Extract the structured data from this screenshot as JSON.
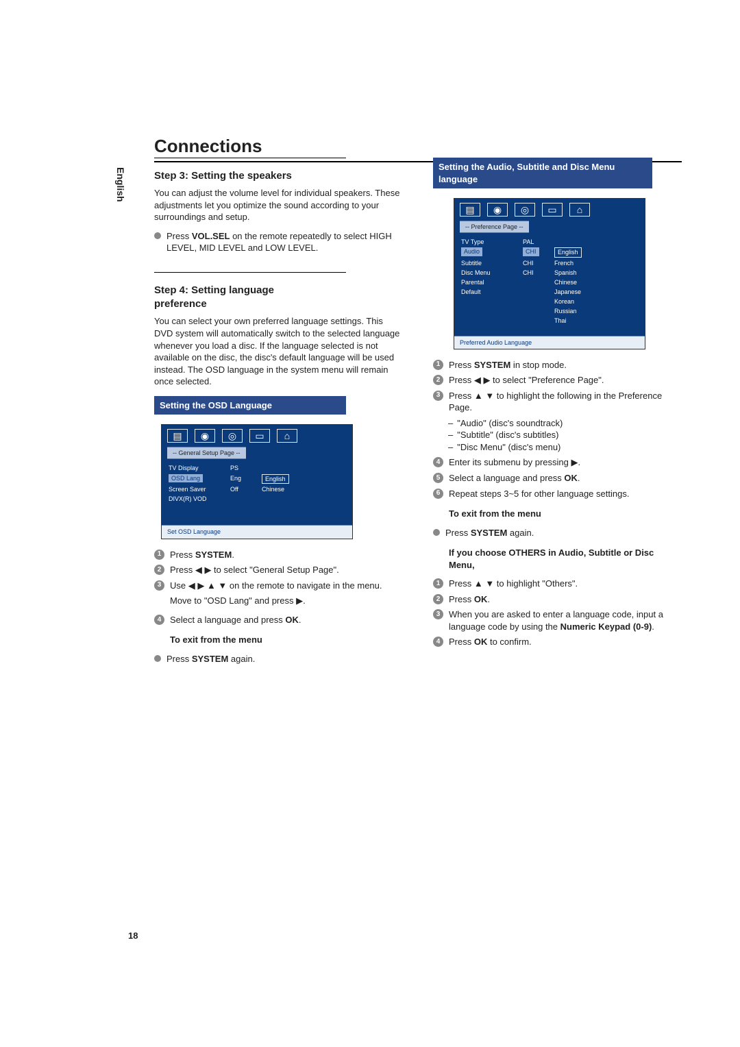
{
  "lang_tab": "English",
  "title": "Connections",
  "page_number": "18",
  "left": {
    "step3_title": "Step 3:  Setting the speakers",
    "step3_text": "You can adjust the volume level for individual speakers. These adjustments let you optimize the sound according to your surroundings and setup.",
    "step3_bullet_pre": "Press ",
    "step3_bullet_bold": "VOL.SEL",
    "step3_bullet_post": " on the remote repeatedly to select HIGH LEVEL, MID LEVEL and LOW LEVEL.",
    "step4_title": "Step 4:  Setting language preference",
    "step4_text": "You can select your own preferred language settings. This DVD system will automatically switch to the selected language whenever you load a disc. If the language selected is not available on the disc, the disc's default language will be used instead. The OSD language in the system menu will remain once selected.",
    "osd_bar": "Setting the OSD Language",
    "osd_fig": {
      "title": "-- General Setup Page --",
      "rows": [
        {
          "a": "TV Display",
          "b": "PS",
          "c": ""
        },
        {
          "a": "OSD Lang",
          "b": "Eng",
          "c": "English",
          "hlA": true,
          "boxC": true
        },
        {
          "a": "Screen Saver",
          "b": "Off",
          "c": "Chinese"
        },
        {
          "a": "DIVX(R) VOD",
          "b": "",
          "c": ""
        }
      ],
      "footer": "Set OSD Language"
    },
    "s1_pre": "Press ",
    "s1_bold": "SYSTEM",
    "s1_post": ".",
    "s2": "Press ◀ ▶ to select \"General Setup Page\".",
    "s3": "Use ◀ ▶ ▲ ▼ on the remote to navigate in the menu.",
    "s3b": "Move to \"OSD Lang\" and press ▶.",
    "s4_pre": "Select a language and press ",
    "s4_bold": "OK",
    "s4_post": ".",
    "exit_hd": "To exit from the menu",
    "exit_pre": "Press ",
    "exit_bold": "SYSTEM",
    "exit_post": " again."
  },
  "right": {
    "audio_bar": "Setting the Audio, Subtitle and Disc Menu language",
    "pref_fig": {
      "title": "-- Preference Page --",
      "rows": [
        {
          "a": "TV Type",
          "b": "PAL",
          "c": ""
        },
        {
          "a": "Audio",
          "b": "CHI",
          "c": "English",
          "hlA": true,
          "hlB": true,
          "boxC": true
        },
        {
          "a": "Subtitle",
          "b": "CHI",
          "c": "French"
        },
        {
          "a": "Disc Menu",
          "b": "CHI",
          "c": "Spanish"
        },
        {
          "a": "Parental",
          "b": "",
          "c": "Chinese"
        },
        {
          "a": "Default",
          "b": "",
          "c": "Japanese"
        },
        {
          "a": "",
          "b": "",
          "c": "Korean"
        },
        {
          "a": "",
          "b": "",
          "c": "Russian"
        },
        {
          "a": "",
          "b": "",
          "c": "Thai"
        }
      ],
      "footer": "Preferred Audio Language"
    },
    "s1_pre": "Press ",
    "s1_bold": "SYSTEM",
    "s1_post": " in stop mode.",
    "s2": "Press ◀ ▶ to select \"Preference Page\".",
    "s3": "Press ▲ ▼ to highlight the following in the Preference Page.",
    "s3a": "\"Audio\" (disc's soundtrack)",
    "s3b": " \"Subtitle\" (disc's subtitles)",
    "s3c": "\"Disc Menu\" (disc's menu)",
    "s4": "Enter its submenu by pressing ▶.",
    "s5_pre": "Select a language and press ",
    "s5_bold": "OK",
    "s5_post": ".",
    "s6": "Repeat steps 3~5 for other language settings.",
    "exit_hd": "To exit from the menu",
    "exit_pre": "Press ",
    "exit_bold": "SYSTEM",
    "exit_post": " again.",
    "others_hd": "If you choose OTHERS in Audio, Subtitle or Disc Menu,",
    "o1": "Press ▲ ▼ to highlight \"Others\".",
    "o2_pre": "Press ",
    "o2_bold": "OK",
    "o2_post": ".",
    "o3_pre": "When you are asked to enter a language code, input a language code by using the ",
    "o3_bold": "Numeric Keypad (0-9)",
    "o3_post": ".",
    "o4_pre": "Press ",
    "o4_bold": "OK",
    "o4_post": " to confirm."
  }
}
